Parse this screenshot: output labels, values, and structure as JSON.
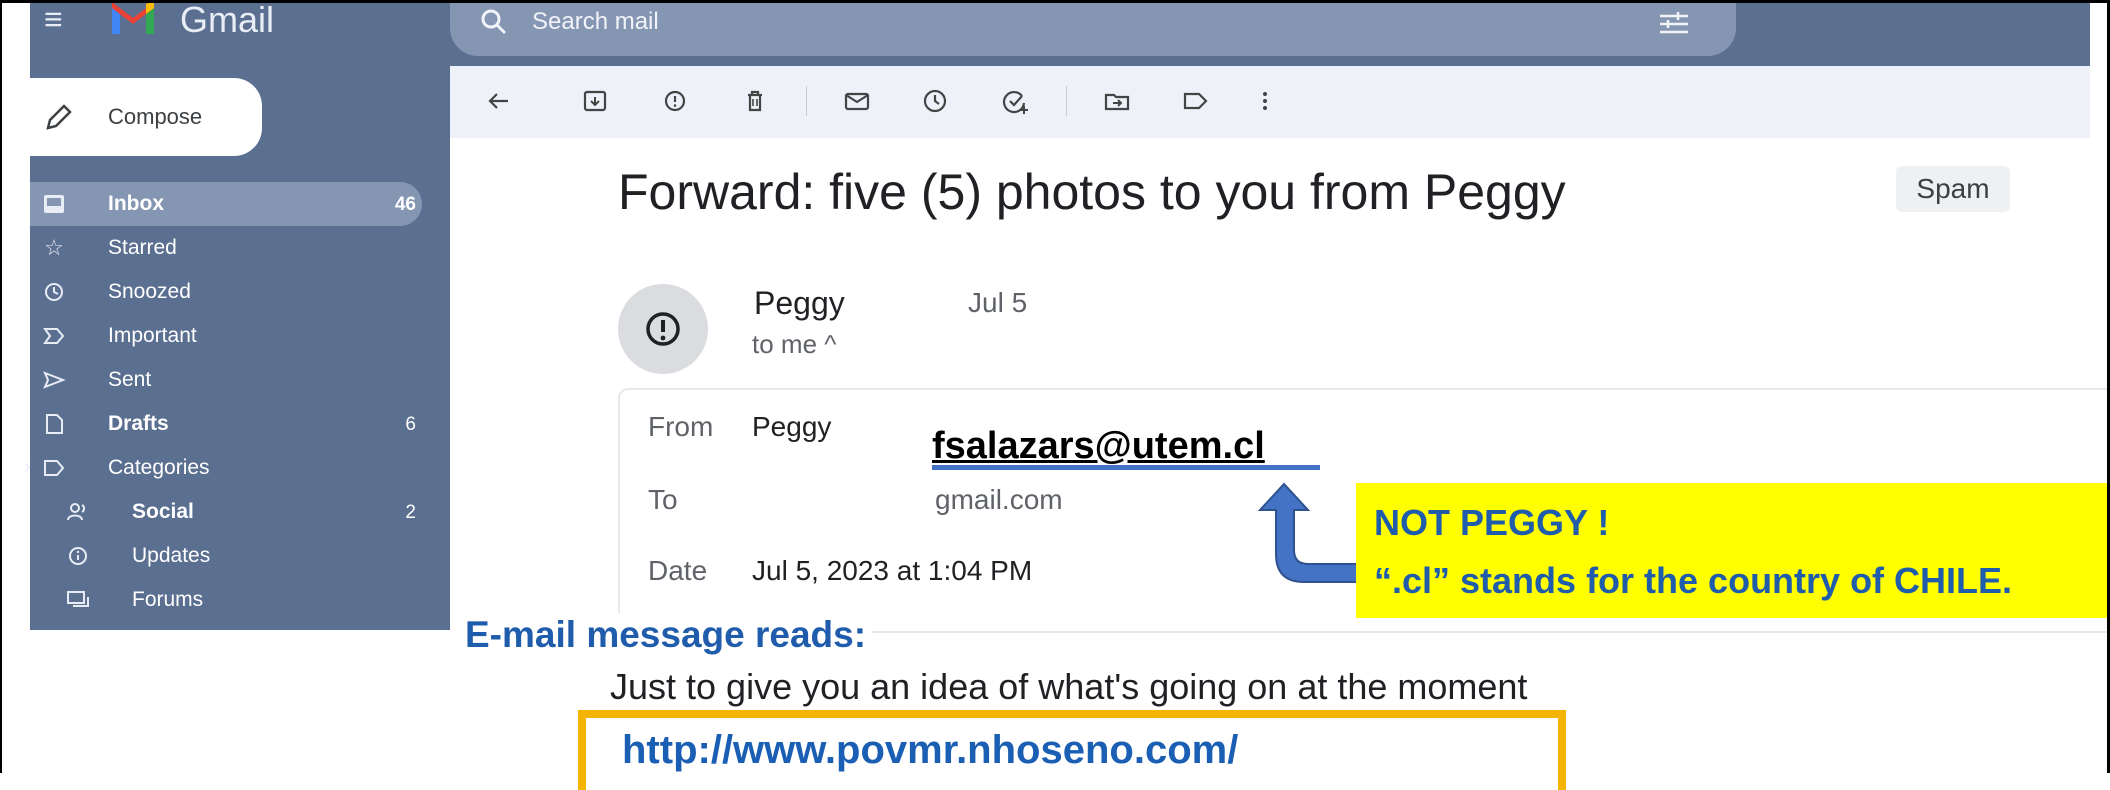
{
  "app": {
    "brand": "Gmail",
    "accent": "#5b6f91"
  },
  "search": {
    "placeholder": "Search mail"
  },
  "compose_label": "Compose",
  "sidebar": {
    "items": [
      {
        "label": "Inbox",
        "count": "46",
        "icon": "inbox-icon",
        "active": true,
        "bold": true
      },
      {
        "label": "Starred",
        "count": "",
        "icon": "star-icon"
      },
      {
        "label": "Snoozed",
        "count": "",
        "icon": "clock-icon"
      },
      {
        "label": "Important",
        "count": "",
        "icon": "important-icon"
      },
      {
        "label": "Sent",
        "count": "",
        "icon": "send-icon"
      },
      {
        "label": "Drafts",
        "count": "6",
        "icon": "draft-icon",
        "bold": true
      },
      {
        "label": "Categories",
        "count": "",
        "icon": "label-icon"
      },
      {
        "label": "Social",
        "count": "2",
        "icon": "people-icon",
        "bold": true,
        "sub": true
      },
      {
        "label": "Updates",
        "count": "",
        "icon": "info-icon",
        "sub": true
      },
      {
        "label": "Forums",
        "count": "",
        "icon": "forum-icon",
        "sub": true
      }
    ]
  },
  "toolbar": {
    "icons": [
      "back-arrow-icon",
      "archive-icon",
      "report-spam-icon",
      "delete-icon",
      "mark-unread-icon",
      "snooze-icon",
      "add-task-icon",
      "move-to-icon",
      "label-icon",
      "more-options-icon"
    ]
  },
  "email": {
    "subject": "Forward: five (5) photos to you from Peggy",
    "label": "Spam",
    "sender": "Peggy",
    "date_short": "Jul 5",
    "to_me": "to me ^",
    "details": {
      "from_label": "From",
      "from_value": "Peggy",
      "to_label": "To",
      "to_value": "gmail.com",
      "date_label": "Date",
      "date_value": "Jul 5, 2023 at 1:04 PM"
    },
    "body": "Just to give you an idea of what's going on at the moment",
    "link": "http://www.povmr.nhoseno.com/"
  },
  "annotations": {
    "sender_address": "fsalazars@utem.cl",
    "callout_line1": "NOT PEGGY !",
    "callout_line2": "“.cl” stands for the country of CHILE.",
    "message_reads": "E-mail message reads:",
    "callout_color": "#ffff00",
    "text_color": "#1f5cab",
    "link_box_color": "#f4b400"
  }
}
